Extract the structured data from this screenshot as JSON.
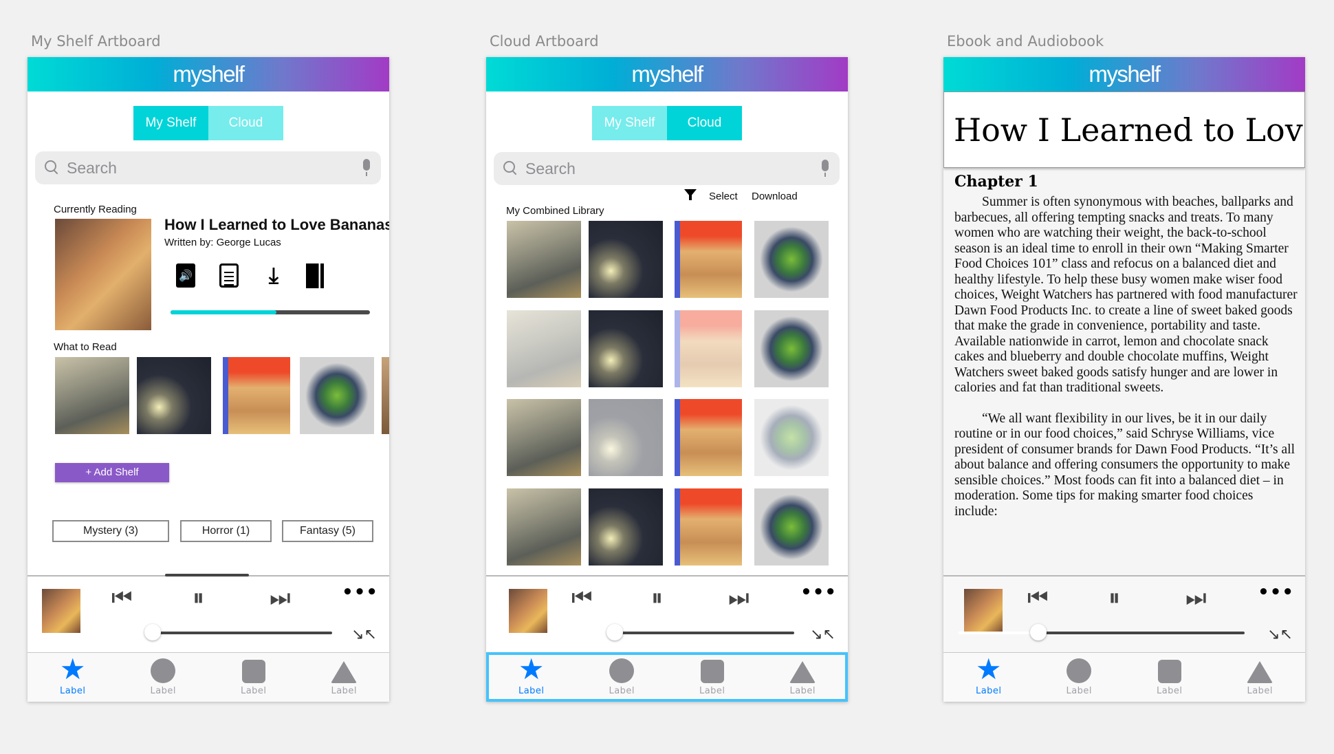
{
  "artboards": {
    "shelf": {
      "label": "My Shelf Artboard"
    },
    "cloud": {
      "label": "Cloud Artboard"
    },
    "ebook": {
      "label": "Ebook and Audiobook"
    }
  },
  "app": {
    "brand": "myshelf"
  },
  "segment": {
    "my_shelf": "My Shelf",
    "cloud": "Cloud"
  },
  "search": {
    "placeholder": "Search"
  },
  "shelf": {
    "currently_reading_label": "Currently Reading",
    "book_title": "How I Learned to Love Bananas:",
    "author": "Written by: George Lucas",
    "actions": [
      "audiobook-icon",
      "ebook-icon",
      "download-icon",
      "bookmark-icon"
    ],
    "progress": 0.53,
    "what_to_read_label": "What to Read",
    "add_shelf": "+ Add Shelf",
    "genres": [
      "Mystery (3)",
      "Horror (1)",
      "Fantasy (5)"
    ]
  },
  "cloud": {
    "filter_icon": "filter-icon",
    "select": "Select",
    "download": "Download",
    "library_label": "My Combined Library",
    "grid": [
      [
        {
          "c": "knight",
          "f": false
        },
        {
          "c": "dark",
          "f": false
        },
        {
          "c": "potter",
          "f": false
        },
        {
          "c": "island",
          "f": false
        }
      ],
      [
        {
          "c": "knight",
          "f": true
        },
        {
          "c": "dark",
          "f": false
        },
        {
          "c": "potter",
          "f": true
        },
        {
          "c": "island",
          "f": false
        }
      ],
      [
        {
          "c": "knight",
          "f": false
        },
        {
          "c": "dark",
          "f": true
        },
        {
          "c": "potter",
          "f": false
        },
        {
          "c": "island",
          "f": true
        }
      ],
      [
        {
          "c": "knight",
          "f": false
        },
        {
          "c": "dark",
          "f": false
        },
        {
          "c": "potter",
          "f": false
        },
        {
          "c": "island",
          "f": false
        }
      ]
    ]
  },
  "ebook": {
    "title": "How I Learned to Love Bananas",
    "chapter": "Chapter 1",
    "paragraphs": [
      "Summer is often synonymous with beaches, ballparks and barbecues, all offering tempting snacks and treats. To many women who are watching their weight, the back-to-school season is an ideal time to enroll in their own “Making Smarter Food Choices 101” class and refocus on a balanced diet and healthy lifestyle. To help these busy women make wiser food choices, Weight Watchers has partnered with food manufacturer Dawn Food Products Inc. to create a line of sweet baked goods that make the grade in convenience, portability and taste. Available nationwide in carrot, lemon and chocolate snack cakes and blueberry and double chocolate muffins, Weight Watchers sweet baked goods satisfy hunger and are lower in calories and fat than traditional sweets.",
      "“We all want flexibility in our lives, be it in our daily routine or in our food choices,” said Schryse Williams, vice president of consumer brands for Dawn Food Products. “It’s all about balance and offering consumers the opportunity to make sensible choices.” Most foods can fit into a balanced diet – in moderation. Some tips for making smarter food choices include:"
    ]
  },
  "player": {
    "playback_position": 0.0,
    "ebook_playback_position": 0.28
  },
  "tabbar": {
    "labels": [
      "Label",
      "Label",
      "Label",
      "Label"
    ]
  },
  "colors": {
    "accent": "#00d4d8",
    "accent_light": "#76ecec",
    "purple": "#8a59c8",
    "tab_active": "#007aff",
    "selection": "#45c3fb"
  }
}
